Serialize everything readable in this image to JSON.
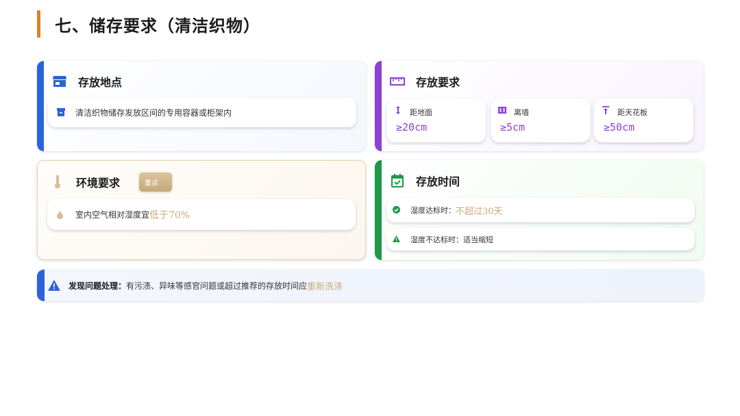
{
  "page": {
    "title": "七、储存要求（清洁织物）"
  },
  "colors": {
    "title_accent": "#d9822b",
    "blue": "#2b63d9",
    "purple": "#8e3fd6",
    "green": "#1c9a45",
    "gold": "#c9a978"
  },
  "storage_location": {
    "title": "存放地点",
    "icon": "store-icon",
    "item": {
      "icon": "archive-box-icon",
      "text": "清洁织物储存发放区间的专用容器或柜架内"
    }
  },
  "storage_requirements": {
    "title": "存放要求",
    "icon": "ruler-icon",
    "items": [
      {
        "icon": "vertical-arrows-icon",
        "label": "距地面",
        "value": "≥20cm"
      },
      {
        "icon": "wall-icon",
        "label": "离墙",
        "value": "≥5cm"
      },
      {
        "icon": "ceiling-arrow-icon",
        "label": "距天花板",
        "value": "≥50cm"
      }
    ]
  },
  "environment": {
    "title": "环境要求",
    "icon": "thermometer-icon",
    "badge": "重点",
    "item": {
      "icon": "droplet-icon",
      "text": "室内空气相对湿度宜",
      "highlight": "低于70%"
    }
  },
  "storage_time": {
    "title": "存放时间",
    "icon": "calendar-check-icon",
    "items": [
      {
        "icon": "check-circle-icon",
        "text": "湿度达标时：",
        "highlight": "不超过30天"
      },
      {
        "icon": "warning-icon",
        "text": "湿度不达标时：适当缩短",
        "highlight": ""
      }
    ]
  },
  "notice": {
    "icon": "alert-triangle-icon",
    "label": "发现问题处理：",
    "text": "有污渍、异味等感官问题或超过推荐的存放时间应",
    "highlight": "重新洗涤"
  }
}
